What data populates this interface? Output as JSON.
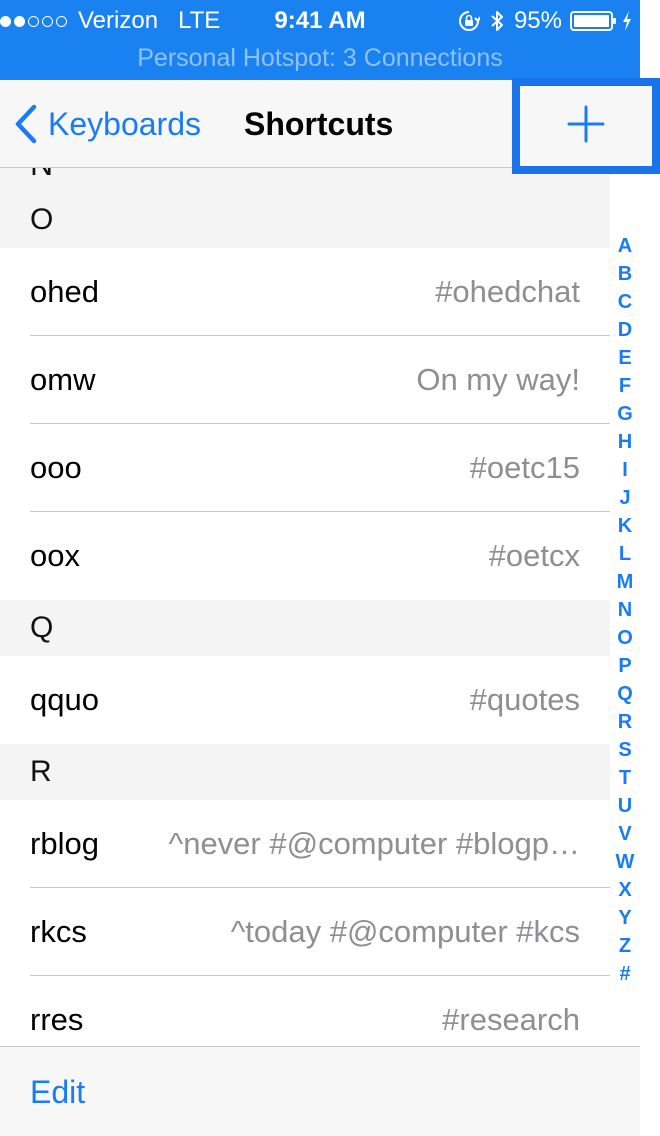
{
  "status_bar": {
    "carrier": "Verizon",
    "network": "LTE",
    "time": "9:41 AM",
    "battery_percent": "95%",
    "signal_bars_full": 2,
    "signal_bars_total": 5,
    "icons": [
      "rotation-lock-icon",
      "bluetooth-icon",
      "battery-icon",
      "charging-icon"
    ],
    "background_color": "#1a82f0"
  },
  "hotspot": {
    "text": "Personal Hotspot: 3 Connections"
  },
  "nav": {
    "back_label": "Keyboards",
    "title": "Shortcuts",
    "add_icon": "plus-icon",
    "accent_color": "#1a7cf5",
    "highlight_color": "#1a73e8"
  },
  "list": {
    "partial_header": "N",
    "sections": [
      {
        "letter": "O",
        "rows": [
          {
            "shortcut": "ohed",
            "phrase": "#ohedchat"
          },
          {
            "shortcut": "omw",
            "phrase": "On my way!"
          },
          {
            "shortcut": "ooo",
            "phrase": "#oetc15"
          },
          {
            "shortcut": "oox",
            "phrase": "#oetcx"
          }
        ]
      },
      {
        "letter": "Q",
        "rows": [
          {
            "shortcut": "qquo",
            "phrase": "#quotes"
          }
        ]
      },
      {
        "letter": "R",
        "rows": [
          {
            "shortcut": "rblog",
            "phrase": "^never #@computer #blogp…"
          },
          {
            "shortcut": "rkcs",
            "phrase": "^today #@computer #kcs"
          },
          {
            "shortcut": "rres",
            "phrase": "#research"
          }
        ]
      }
    ]
  },
  "index": [
    "A",
    "B",
    "C",
    "D",
    "E",
    "F",
    "G",
    "H",
    "I",
    "J",
    "K",
    "L",
    "M",
    "N",
    "O",
    "P",
    "Q",
    "R",
    "S",
    "T",
    "U",
    "V",
    "W",
    "X",
    "Y",
    "Z",
    "#"
  ],
  "toolbar": {
    "edit_label": "Edit"
  }
}
